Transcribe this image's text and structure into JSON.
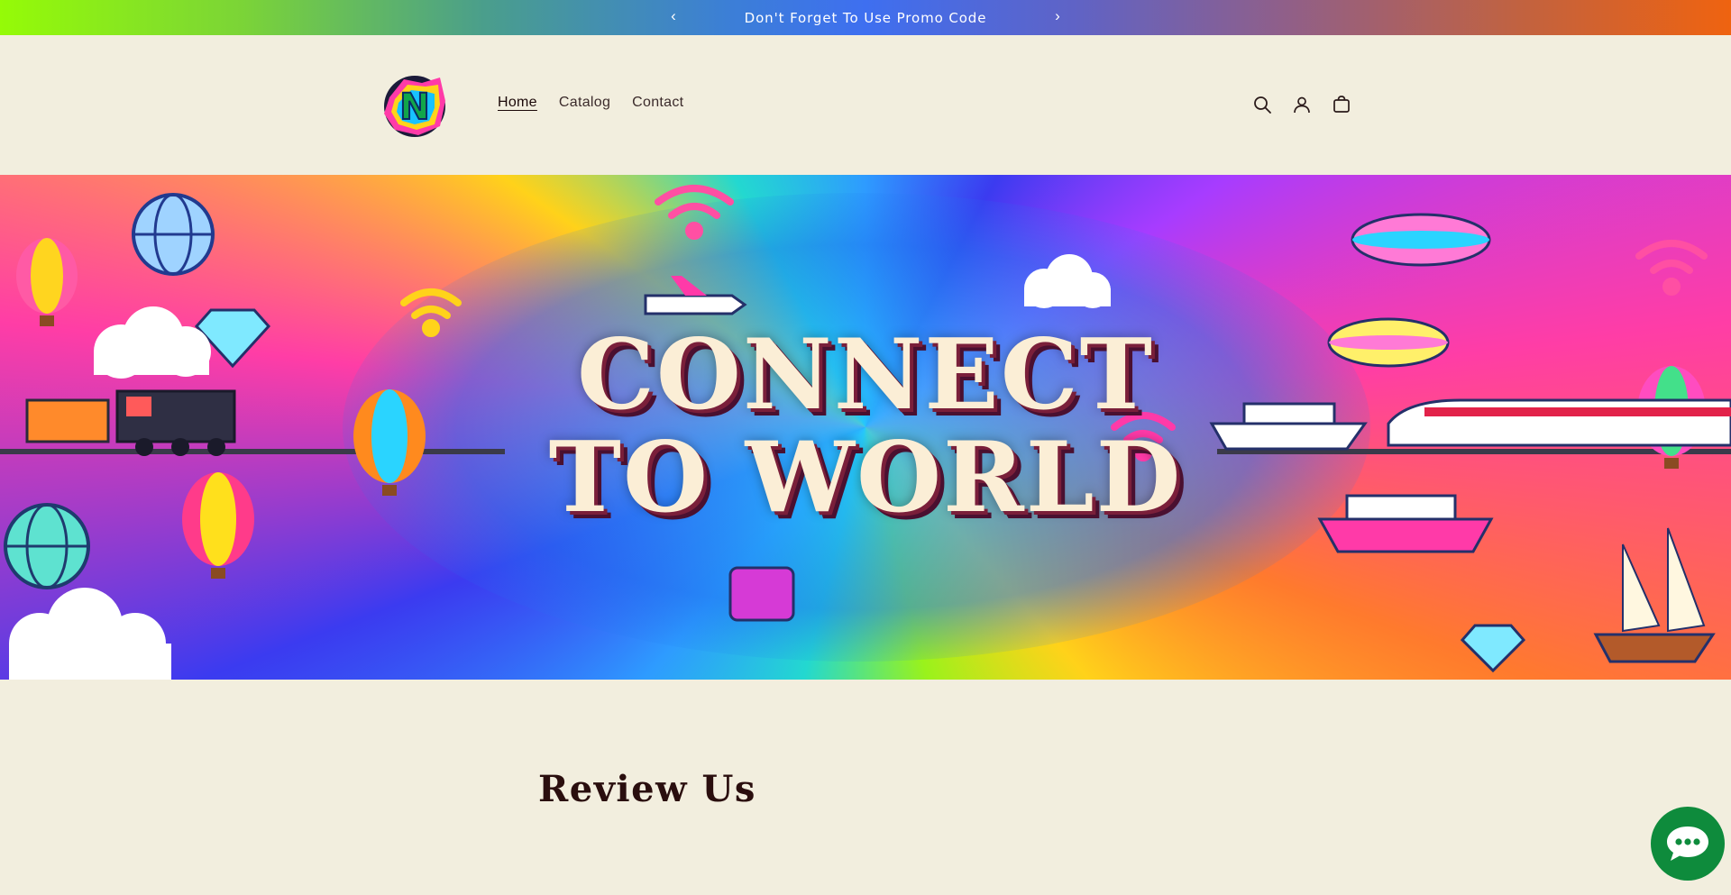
{
  "announcement": {
    "text": "Don't Forget To Use Promo Code"
  },
  "header": {
    "logo_letter": "N",
    "nav": [
      {
        "label": "Home",
        "active": true
      },
      {
        "label": "Catalog",
        "active": false
      },
      {
        "label": "Contact",
        "active": false
      }
    ],
    "icons": [
      "search-icon",
      "account-icon",
      "cart-icon"
    ]
  },
  "hero": {
    "line1": "CONNECT",
    "line2": "TO WORLD"
  },
  "section": {
    "title": "Review Us"
  },
  "colors": {
    "background": "#f2eede",
    "text": "#2a0e0e",
    "chat": "#0e8b3c",
    "announce_start": "#95fb07",
    "announce_end": "#ef6310"
  }
}
